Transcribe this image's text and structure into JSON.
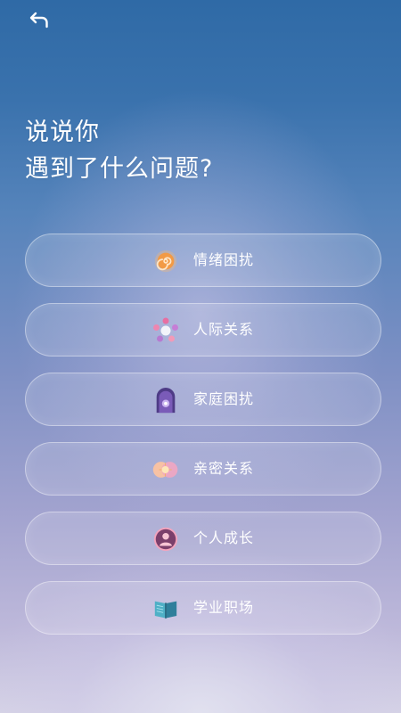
{
  "header": {
    "back_icon": "back-arrow-icon"
  },
  "title": {
    "line1": "说说你",
    "line2": "遇到了什么问题?"
  },
  "options": [
    {
      "label": "情绪困扰",
      "icon": "swirl-icon"
    },
    {
      "label": "人际关系",
      "icon": "people-ring-icon"
    },
    {
      "label": "家庭困扰",
      "icon": "door-icon"
    },
    {
      "label": "亲密关系",
      "icon": "hearts-icon"
    },
    {
      "label": "个人成长",
      "icon": "person-icon"
    },
    {
      "label": "学业职场",
      "icon": "book-icon"
    }
  ],
  "colors": {
    "background_top": "#2f6aa6",
    "background_bottom": "#d6d3e6",
    "text": "#ffffff",
    "swirl_orange": "#f0913a",
    "people_pink": "#e76fa2",
    "door_purple": "#6f55a6",
    "hearts_peach": "#f3b08d",
    "person_plum": "#7b3f6b",
    "book_teal": "#3f9ab1"
  }
}
